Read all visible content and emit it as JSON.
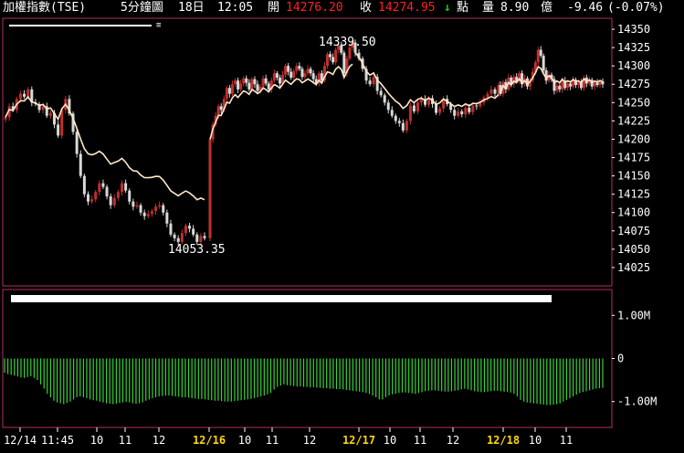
{
  "header": {
    "index_name": "加權指數(TSE)",
    "period": "5分鐘圖",
    "date": "18日",
    "time": "12:05",
    "open_label": "開",
    "open_value": "14276.20",
    "close_label": "收",
    "close_value": "14274.95",
    "change_arrow": "↓",
    "point_label": "點",
    "volume_label": "量",
    "volume_value": "8.90",
    "volume_unit": "億",
    "change_value": "-9.46",
    "change_pct": "(-0.07%)"
  },
  "colors": {
    "background": "#000000",
    "frame": "#b03060",
    "up": "#c03030",
    "down": "#d8d8d8",
    "ma": "#ffe8c8",
    "osc": "#37d337",
    "price_red": "#ff2020",
    "down_arrow": "#22cc22"
  },
  "chart_data": [
    {
      "type": "candlestick",
      "ylim": [
        14000,
        14365
      ],
      "y_ticks": [
        14025,
        14050,
        14075,
        14100,
        14125,
        14150,
        14175,
        14200,
        14225,
        14250,
        14275,
        14300,
        14325,
        14350
      ],
      "high_annotation": "14339.50",
      "low_annotation": "14053.35",
      "days": [
        {
          "date": "12/14",
          "closes": [
            14230,
            14245,
            14240,
            14255,
            14262,
            14258,
            14268,
            14250,
            14248,
            14240,
            14245,
            14232,
            14236,
            14220,
            14205,
            14240,
            14255,
            14235,
            14210,
            14180,
            14150,
            14125,
            14115,
            14118,
            14128,
            14140,
            14135,
            14122,
            14110,
            14120,
            14128,
            14140,
            14130,
            14115,
            14108,
            14110,
            14100,
            14095,
            14098,
            14102,
            14108,
            14110,
            14100,
            14085,
            14070,
            14065,
            14060,
            14072,
            14082,
            14078,
            14070,
            14060,
            14068,
            14065
          ]
        },
        {
          "date": "12/16",
          "closes": [
            14200,
            14220,
            14232,
            14245,
            14240,
            14255,
            14270,
            14262,
            14275,
            14280,
            14268,
            14276,
            14283,
            14277,
            14268,
            14282,
            14275,
            14266,
            14272,
            14283,
            14276,
            14268,
            14280,
            14290,
            14284,
            14276,
            14288,
            14300,
            14292,
            14284,
            14293,
            14300,
            14296,
            14285,
            14290,
            14296,
            14290,
            14282,
            14276,
            14290,
            14280,
            14300,
            14316,
            14312,
            14305,
            14322,
            14328,
            14318,
            14290,
            14310,
            14325,
            14332
          ]
        },
        {
          "date": "12/17",
          "closes": [
            14318,
            14310,
            14296,
            14280,
            14275,
            14285,
            14266,
            14260,
            14250,
            14240,
            14232,
            14225,
            14222,
            14212,
            14225,
            14246,
            14238,
            14250,
            14255,
            14247,
            14256,
            14248,
            14236,
            14242,
            14255,
            14248,
            14240,
            14232,
            14238,
            14234,
            14243,
            14237,
            14246,
            14245,
            14250,
            14257,
            14262,
            14268,
            14262,
            14274
          ]
        },
        {
          "date": "12/18",
          "closes": [
            14262,
            14278,
            14268,
            14284,
            14275,
            14285,
            14279,
            14290,
            14275,
            14283,
            14272,
            14280,
            14292,
            14305,
            14322,
            14314,
            14294,
            14280,
            14288,
            14282,
            14266,
            14273,
            14268,
            14280,
            14270,
            14276,
            14272,
            14281,
            14274,
            14277,
            14270,
            14284,
            14276,
            14281,
            14272,
            14277,
            14274,
            14279,
            14275
          ]
        }
      ],
      "ma_series": "average price line (cream)"
    },
    {
      "type": "bar",
      "ylim": [
        -1.6,
        1.6
      ],
      "y_ticks": [
        {
          "value": 1,
          "label": "1.00M"
        },
        {
          "value": 0,
          "label": "0"
        },
        {
          "value": -1,
          "label": "-1.00M"
        }
      ],
      "values_note": "negative bars, green",
      "values": [
        -0.33,
        -0.36,
        -0.38,
        -0.4,
        -0.42,
        -0.44,
        -0.45,
        -0.43,
        -0.41,
        -0.45,
        -0.5,
        -0.6,
        -0.7,
        -0.82,
        -0.9,
        -0.98,
        -1.02,
        -1.04,
        -1.06,
        -1.03,
        -1,
        -0.95,
        -0.9,
        -0.88,
        -0.9,
        -0.92,
        -0.95,
        -0.97,
        -0.98,
        -1,
        -1.02,
        -1.04,
        -1.05,
        -1.06,
        -1.05,
        -1.03,
        -1.02,
        -1.01,
        -1.02,
        -1.04,
        -1.05,
        -1.04,
        -1.02,
        -0.98,
        -0.95,
        -0.92,
        -0.9,
        -0.88,
        -0.87,
        -0.86,
        -0.86,
        -0.87,
        -0.88,
        -0.89,
        -0.9,
        -0.9,
        -0.91,
        -0.92,
        -0.93,
        -0.94,
        -0.94,
        -0.95,
        -0.96,
        -0.97,
        -0.98,
        -0.98,
        -0.99,
        -1,
        -1,
        -1,
        -0.99,
        -0.98,
        -0.97,
        -0.96,
        -0.95,
        -0.94,
        -0.92,
        -0.9,
        -0.88,
        -0.86,
        -0.83,
        -0.8,
        -0.72,
        -0.66,
        -0.63,
        -0.6,
        -0.62,
        -0.63,
        -0.64,
        -0.65,
        -0.65,
        -0.66,
        -0.66,
        -0.67,
        -0.67,
        -0.68,
        -0.68,
        -0.69,
        -0.69,
        -0.7,
        -0.7,
        -0.71,
        -0.71,
        -0.72,
        -0.73,
        -0.74,
        -0.75,
        -0.76,
        -0.77,
        -0.78,
        -0.8,
        -0.82,
        -0.86,
        -0.9,
        -0.95,
        -0.95,
        -0.9,
        -0.86,
        -0.83,
        -0.82,
        -0.8,
        -0.79,
        -0.79,
        -0.8,
        -0.81,
        -0.82,
        -0.8,
        -0.78,
        -0.76,
        -0.75,
        -0.74,
        -0.74,
        -0.75,
        -0.76,
        -0.77,
        -0.77,
        -0.76,
        -0.75,
        -0.74,
        -0.72,
        -0.7,
        -0.72,
        -0.74,
        -0.76,
        -0.77,
        -0.78,
        -0.78,
        -0.77,
        -0.76,
        -0.75,
        -0.75,
        -0.76,
        -0.77,
        -0.78,
        -0.79,
        -0.82,
        -0.88,
        -0.96,
        -1,
        -1.02,
        -1.03,
        -1.04,
        -1.05,
        -1.06,
        -1.07,
        -1.08,
        -1.08,
        -1.07,
        -1.06,
        -1.04,
        -1,
        -0.96,
        -0.92,
        -0.88,
        -0.84,
        -0.8,
        -0.78,
        -0.76,
        -0.74,
        -0.72,
        -0.7,
        -0.69,
        -0.68
      ]
    }
  ],
  "x_axis": {
    "labels": [
      {
        "text": "12/14",
        "x": 22,
        "date": false
      },
      {
        "text": "11:45",
        "x": 63,
        "date": false
      },
      {
        "text": "10",
        "x": 106,
        "date": false
      },
      {
        "text": "11",
        "x": 137,
        "date": false
      },
      {
        "text": "12",
        "x": 174,
        "date": false
      },
      {
        "text": "12/16",
        "x": 229,
        "date": true
      },
      {
        "text": "10",
        "x": 268,
        "date": false
      },
      {
        "text": "11",
        "x": 298,
        "date": false
      },
      {
        "text": "12",
        "x": 339,
        "date": false
      },
      {
        "text": "12/17",
        "x": 393,
        "date": true
      },
      {
        "text": "10",
        "x": 427,
        "date": false
      },
      {
        "text": "11",
        "x": 460,
        "date": false
      },
      {
        "text": "12",
        "x": 496,
        "date": false
      },
      {
        "text": "12/18",
        "x": 551,
        "date": true
      },
      {
        "text": "10",
        "x": 586,
        "date": false
      },
      {
        "text": "11",
        "x": 620,
        "date": false
      }
    ]
  }
}
